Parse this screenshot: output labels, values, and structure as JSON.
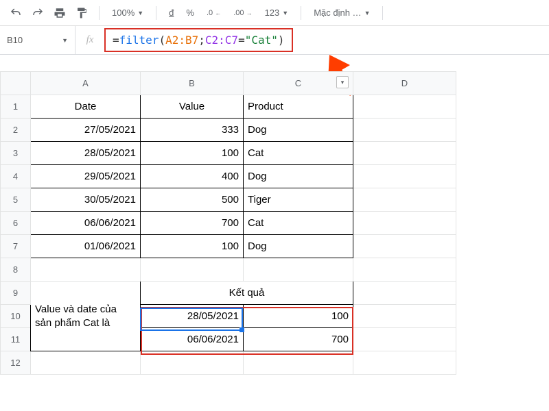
{
  "toolbar": {
    "zoom": "100%",
    "currency": "đ",
    "percent": "%",
    "dec_minus": ".0",
    "dec_plus": ".00",
    "num_format": "123",
    "font": "Mặc định …"
  },
  "namebox": "B10",
  "formula": {
    "prefix": "=",
    "fn": "filter",
    "open": "(",
    "r1": "A2:B7",
    "sep": ";",
    "r2": "C2:C7",
    "op": "=",
    "str": "\"Cat\"",
    "close": ")"
  },
  "columns": [
    "A",
    "B",
    "C",
    "D"
  ],
  "rows": [
    "1",
    "2",
    "3",
    "4",
    "5",
    "6",
    "7",
    "8",
    "9",
    "10",
    "11",
    "12"
  ],
  "headers": {
    "date": "Date",
    "value": "Value",
    "product": "Product"
  },
  "data": [
    {
      "date": "27/05/2021",
      "value": "333",
      "product": "Dog"
    },
    {
      "date": "28/05/2021",
      "value": "100",
      "product": "Cat"
    },
    {
      "date": "29/05/2021",
      "value": "400",
      "product": "Dog"
    },
    {
      "date": "30/05/2021",
      "value": "500",
      "product": "Tiger"
    },
    {
      "date": "06/06/2021",
      "value": "700",
      "product": "Cat"
    },
    {
      "date": "01/06/2021",
      "value": "100",
      "product": "Dog"
    }
  ],
  "result": {
    "label": "Value và date của sản phẩm Cat là",
    "header": "Kết quả",
    "rows": [
      {
        "date": "28/05/2021",
        "value": "100"
      },
      {
        "date": "06/06/2021",
        "value": "700"
      }
    ]
  }
}
